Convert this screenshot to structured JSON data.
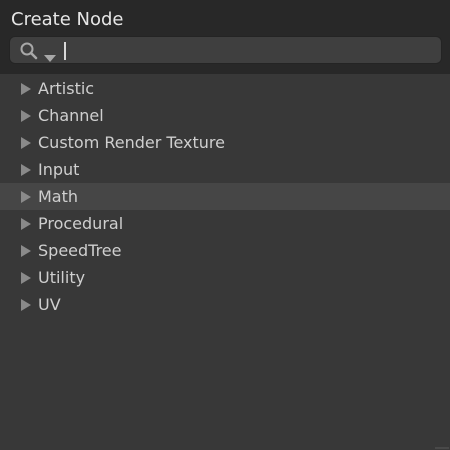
{
  "window": {
    "title": "Create Node"
  },
  "search": {
    "value": "",
    "placeholder": "",
    "icon": "search-icon",
    "dropdown_icon": "chevron-down-icon"
  },
  "categories": [
    {
      "label": "Artistic",
      "selected": false
    },
    {
      "label": "Channel",
      "selected": false
    },
    {
      "label": "Custom Render Texture",
      "selected": false
    },
    {
      "label": "Input",
      "selected": false
    },
    {
      "label": "Math",
      "selected": true
    },
    {
      "label": "Procedural",
      "selected": false
    },
    {
      "label": "SpeedTree",
      "selected": false
    },
    {
      "label": "Utility",
      "selected": false
    },
    {
      "label": "UV",
      "selected": false
    }
  ],
  "colors": {
    "background": "#383838",
    "header": "#282828",
    "selected_row": "#464646",
    "text": "#cfcfcf",
    "arrow": "#8a8a8a"
  }
}
